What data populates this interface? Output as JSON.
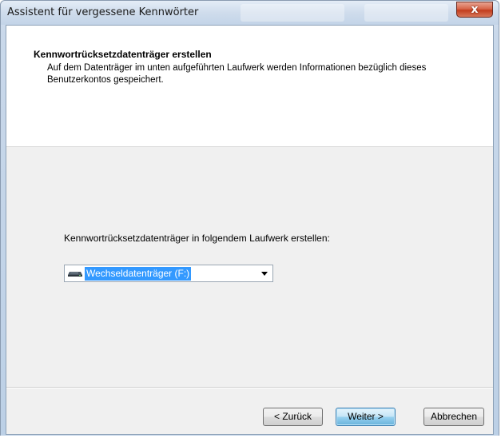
{
  "window": {
    "title": "Assistent für vergessene Kennwörter",
    "close_label": "x"
  },
  "header": {
    "title": "Kennwortrücksetzdatenträger erstellen",
    "description": "Auf dem Datenträger im unten aufgeführten Laufwerk werden Informationen bezüglich dieses Benutzerkontos gespeichert."
  },
  "body": {
    "drive_label": "Kennwortrücksetzdatenträger in folgendem Laufwerk erstellen:",
    "drive_select": {
      "value": "Wechseldatenträger (F:)",
      "icon": "removable-drive-icon"
    }
  },
  "footer": {
    "back_label": "< Zurück",
    "next_label": "Weiter >",
    "cancel_label": "Abbrechen"
  },
  "colors": {
    "selection": "#3399ff",
    "close_button": "#c23d1e",
    "client_background": "#f0f0f0"
  }
}
